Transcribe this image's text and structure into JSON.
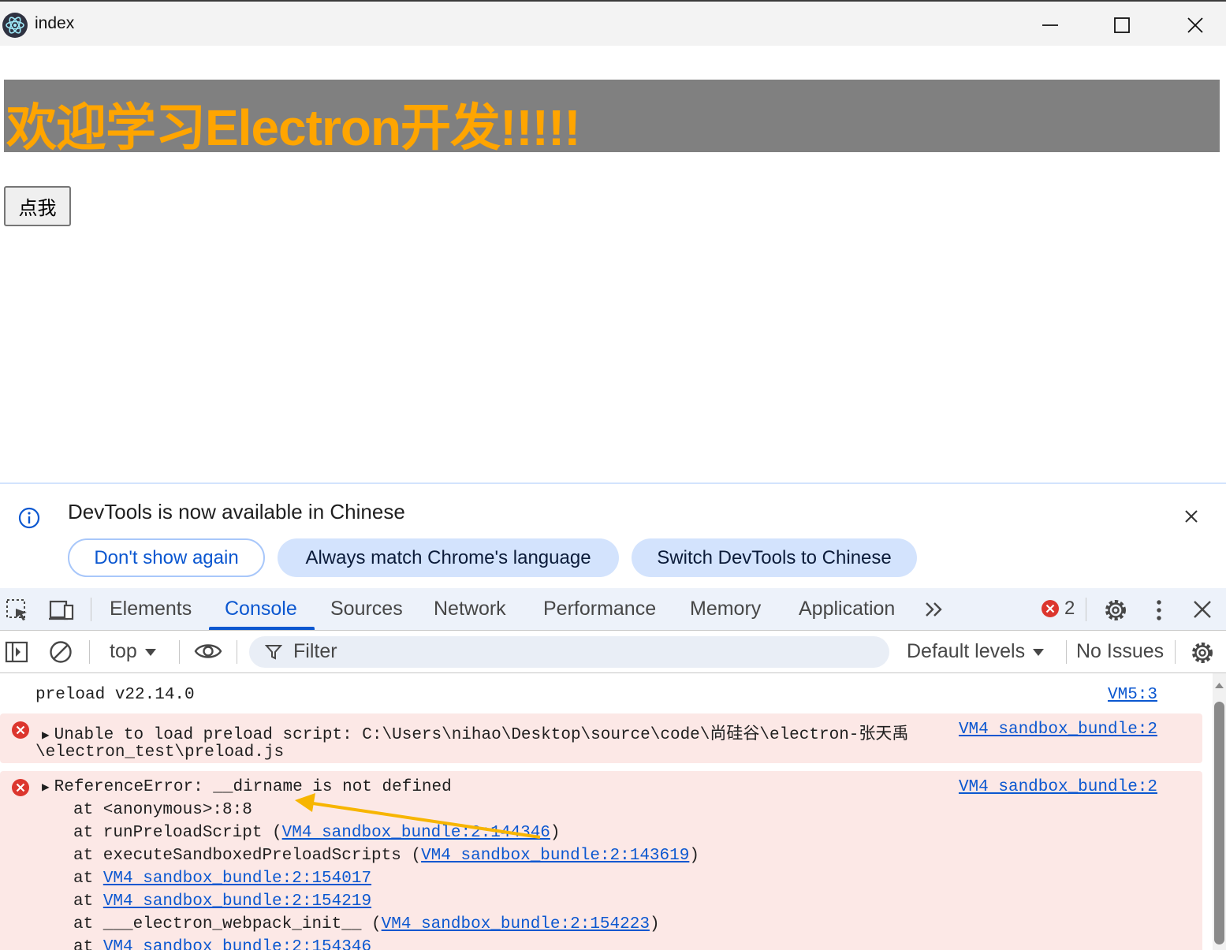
{
  "window": {
    "title": "index",
    "icon": "electron-logo-icon"
  },
  "page": {
    "heading": "欢迎学习Electron开发!!!!!",
    "button_label": "点我",
    "colors": {
      "heading_text": "#ffa500",
      "heading_bg": "#808080"
    }
  },
  "devtools": {
    "infobar": {
      "message": "DevTools is now available in Chinese",
      "buttons": [
        "Don't show again",
        "Always match Chrome's language",
        "Switch DevTools to Chinese"
      ]
    },
    "tabs": [
      "Elements",
      "Console",
      "Sources",
      "Network",
      "Performance",
      "Memory",
      "Application"
    ],
    "active_tab": "Console",
    "error_count": "2",
    "toolbar": {
      "context": "top",
      "filter_placeholder": "Filter",
      "levels": "Default levels",
      "issues": "No Issues"
    },
    "console": {
      "log": {
        "text": "preload v22.14.0",
        "source": "VM5:3"
      },
      "error1": {
        "text": "Unable to load preload script: C:\\Users\\nihao\\Desktop\\source\\code\\尚硅谷\\electron-张天禹",
        "text2": "\\electron_test\\preload.js",
        "source": "VM4 sandbox_bundle:2"
      },
      "error2": {
        "text": "ReferenceError: __dirname is not defined",
        "source": "VM4 sandbox_bundle:2",
        "stack": [
          {
            "prefix": "at <anonymous>:8:8",
            "link": "",
            "suffix": ""
          },
          {
            "prefix": "at runPreloadScript (",
            "link": "VM4 sandbox_bundle:2:144346",
            "suffix": ")"
          },
          {
            "prefix": "at executeSandboxedPreloadScripts (",
            "link": "VM4 sandbox_bundle:2:143619",
            "suffix": ")"
          },
          {
            "prefix": "at ",
            "link": "VM4 sandbox_bundle:2:154017",
            "suffix": ""
          },
          {
            "prefix": "at ",
            "link": "VM4 sandbox_bundle:2:154219",
            "suffix": ""
          },
          {
            "prefix": "at ___electron_webpack_init__ (",
            "link": "VM4 sandbox_bundle:2:154223",
            "suffix": ")"
          },
          {
            "prefix": "at ",
            "link": "VM4 sandbox_bundle:2:154346",
            "suffix": ""
          }
        ]
      }
    },
    "colors": {
      "accent": "#0b57d0",
      "error": "#dc362e",
      "error_bg": "#fce8e6",
      "annotation_arrow": "#f7b500"
    }
  }
}
